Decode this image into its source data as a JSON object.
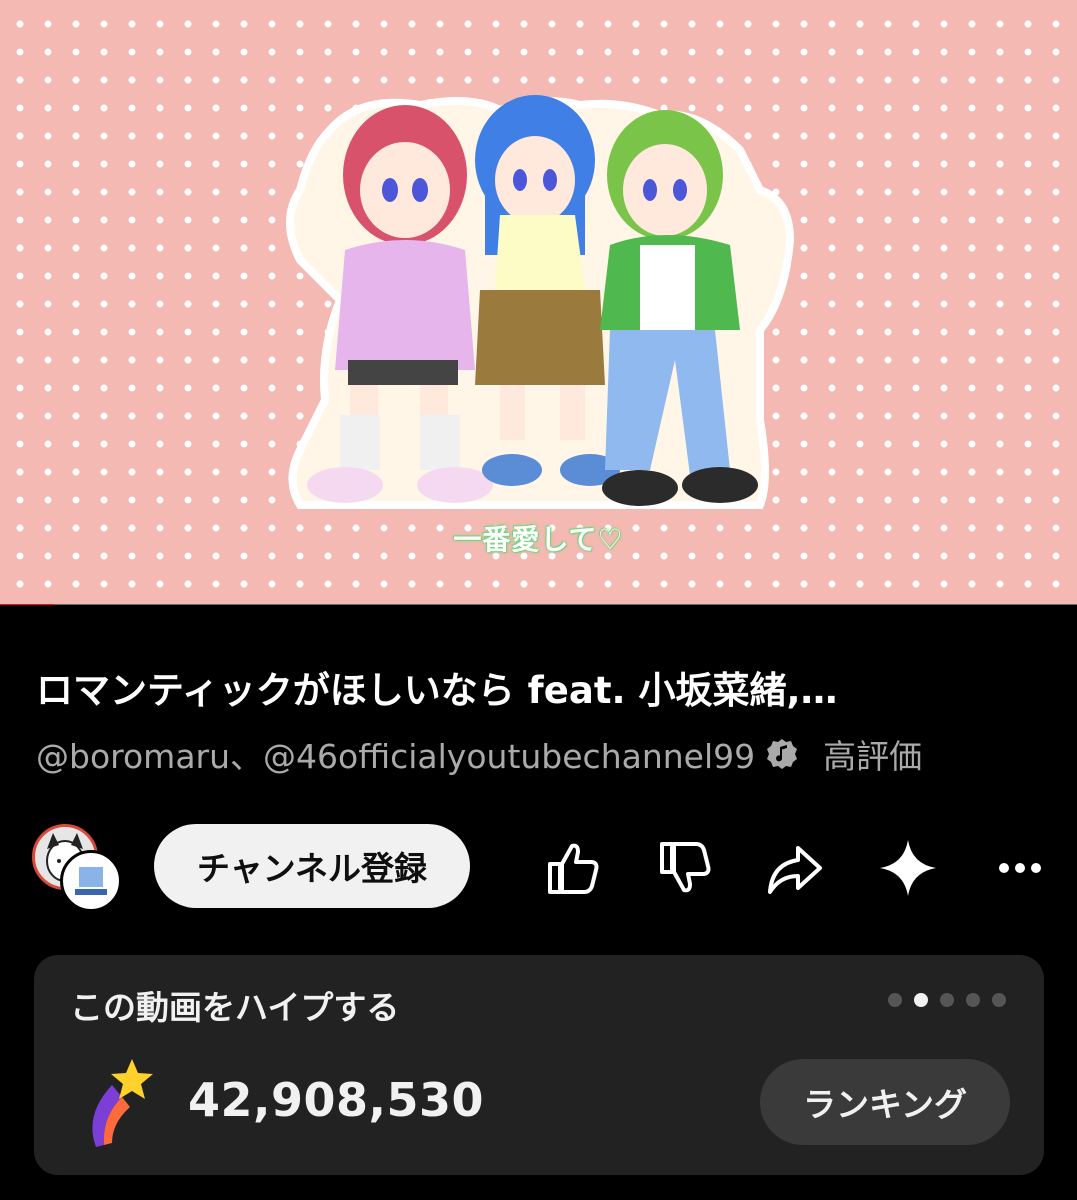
{
  "video": {
    "caption": "一番愛して♡",
    "progress_fraction": 0.05
  },
  "title": "ロマンティックがほしいなら feat. 小坂菜緒,…",
  "channels": {
    "text": "@boromaru、@46officialyoutubechannel99",
    "verified_icon": "music-note-verified-icon",
    "extra": "高評価"
  },
  "actions": {
    "subscribe_label": "チャンネル登録",
    "like_icon": "thumbs-up-icon",
    "dislike_icon": "thumbs-down-icon",
    "share_icon": "share-arrow-icon",
    "ask_icon": "sparkle-icon",
    "more_icon": "more-horizontal-icon"
  },
  "hype": {
    "title": "この動画をハイプする",
    "count": "42,908,530",
    "ranking_label": "ランキング",
    "page_dots": 5,
    "active_dot": 1,
    "icon": "shooting-star-icon"
  },
  "colors": {
    "background": "#000000",
    "video_bg": "#f4b9b2",
    "card_bg": "#222222",
    "accent_red": "#ff0033"
  }
}
